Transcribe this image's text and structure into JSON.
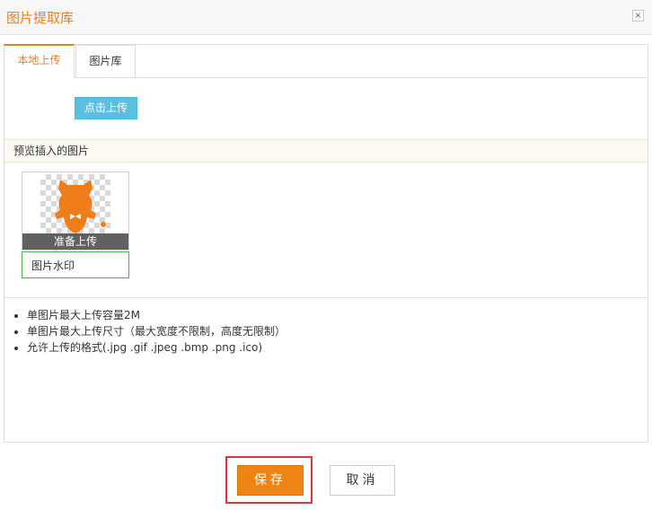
{
  "dialog": {
    "title": "图片提取库",
    "close_icon": "close-icon",
    "close_glyph": "×"
  },
  "tabs": [
    {
      "label": "本地上传",
      "active": true
    },
    {
      "label": "图片库",
      "active": false
    }
  ],
  "upload": {
    "button_label": "点击上传"
  },
  "preview": {
    "header": "预览插入的图片",
    "items": [
      {
        "status": "准备上传",
        "watermark_value": "图片水印"
      }
    ]
  },
  "notes": [
    "单图片最大上传容量2M",
    "单图片最大上传尺寸（最大宽度不限制，高度无限制）",
    "允许上传的格式(.jpg .gif .jpeg .bmp .png .ico)"
  ],
  "footer": {
    "save_label": "保存",
    "cancel_label": "取消"
  },
  "colors": {
    "accent": "#e8801f",
    "upload_button": "#5bc0de",
    "save_button": "#ed8413",
    "highlight": "#e0343b"
  }
}
